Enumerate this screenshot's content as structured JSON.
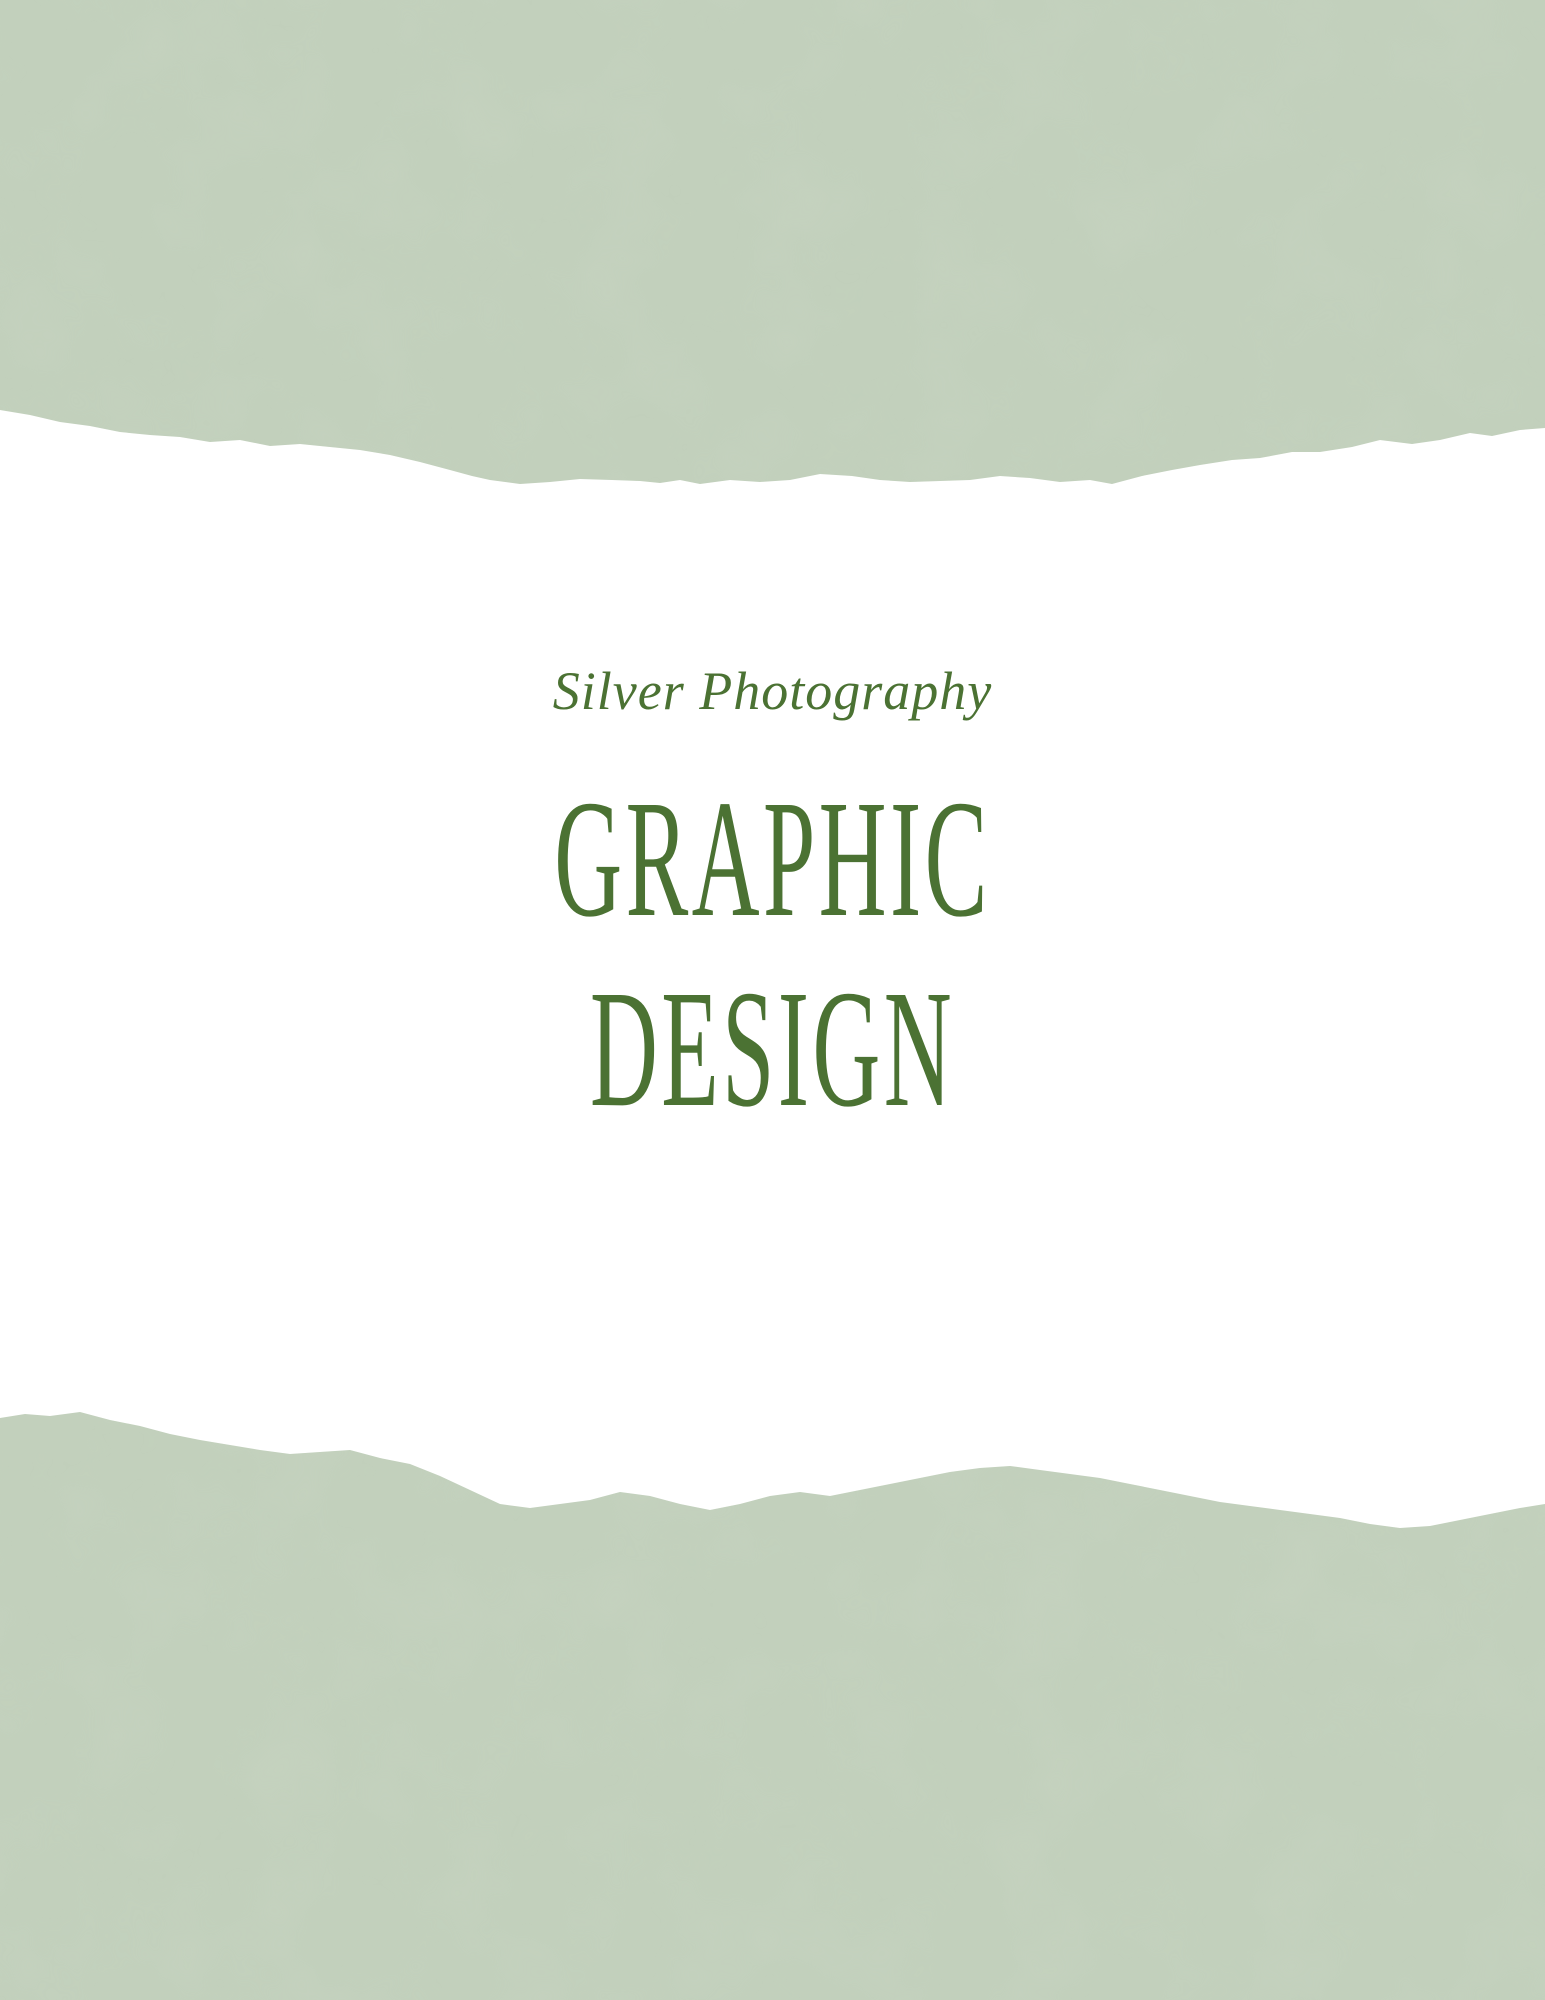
{
  "cover": {
    "subtitle": "Silver Photography",
    "title_line_1": "GRAPHIC",
    "title_line_2": "DESIGN"
  },
  "colors": {
    "background": "#ffffff",
    "paper": "#c2d0bc",
    "paper_dark": "#b3c4ac",
    "text": "#4b7233"
  }
}
